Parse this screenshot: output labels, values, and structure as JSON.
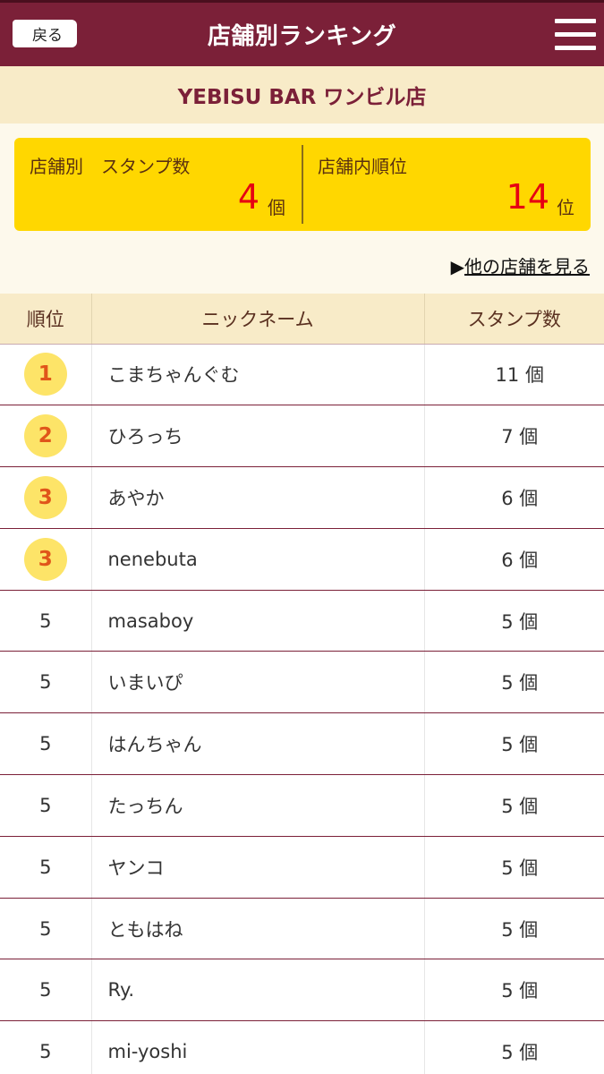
{
  "header": {
    "back_label": "戻る",
    "title": "店舗別ランキング"
  },
  "shop_name": "YEBISU BAR ワンビル店",
  "summary": {
    "stamp_label": "店舗別　スタンプ数",
    "stamp_value": "4",
    "stamp_unit": "個",
    "rank_label": "店舗内順位",
    "rank_value": "14",
    "rank_unit": "位"
  },
  "other_shops_link": {
    "marker": "▶",
    "label": "他の店舗を見る"
  },
  "table": {
    "headers": [
      "順位",
      "ニックネーム",
      "スタンプ数"
    ],
    "rows": [
      {
        "rank": "1",
        "name": "こまちゃんぐむ",
        "count": "11 個",
        "medal": true
      },
      {
        "rank": "2",
        "name": "ひろっち",
        "count": "7 個",
        "medal": true
      },
      {
        "rank": "3",
        "name": "あやか",
        "count": "6 個",
        "medal": true
      },
      {
        "rank": "3",
        "name": "nenebuta",
        "count": "6 個",
        "medal": true
      },
      {
        "rank": "5",
        "name": "masaboy",
        "count": "5 個",
        "medal": false
      },
      {
        "rank": "5",
        "name": "いまいぴ",
        "count": "5 個",
        "medal": false
      },
      {
        "rank": "5",
        "name": "はんちゃん",
        "count": "5 個",
        "medal": false
      },
      {
        "rank": "5",
        "name": "たっちん",
        "count": "5 個",
        "medal": false
      },
      {
        "rank": "5",
        "name": "ヤンコ",
        "count": "5 個",
        "medal": false
      },
      {
        "rank": "5",
        "name": "ともはね",
        "count": "5 個",
        "medal": false
      },
      {
        "rank": "5",
        "name": "Ry.",
        "count": "5 個",
        "medal": false
      },
      {
        "rank": "5",
        "name": "mi-yoshi",
        "count": "5 個",
        "medal": false
      }
    ]
  }
}
